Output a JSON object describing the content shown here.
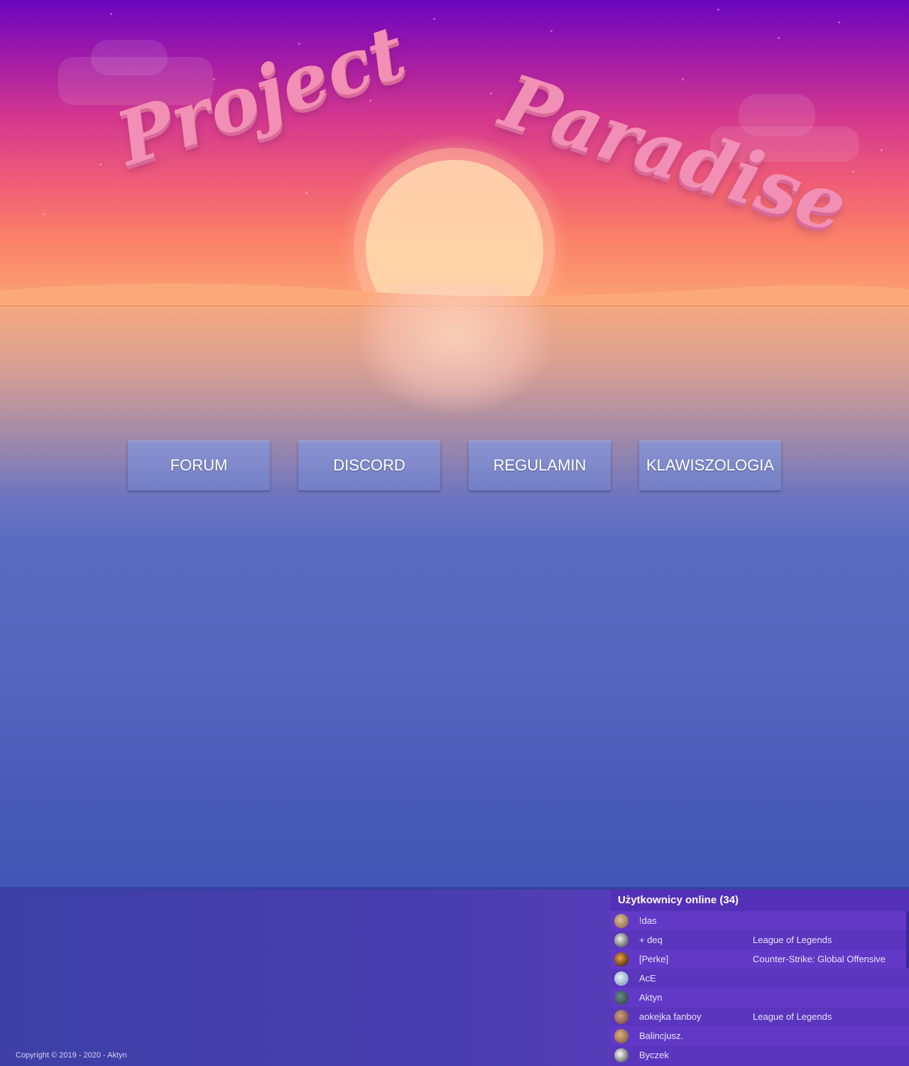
{
  "header": {
    "title_word_1": "Project",
    "title_word_2": "Paradise"
  },
  "nav": {
    "buttons": [
      {
        "label": "FORUM"
      },
      {
        "label": "DISCORD"
      },
      {
        "label": "REGULAMIN"
      },
      {
        "label": "KLAWISZOLOGIA"
      }
    ]
  },
  "footer": {
    "copyright": "Copyright © 2019 - 2020 - Aktyn"
  },
  "online_users": {
    "title": "Użytkownicy online (34)",
    "users": [
      {
        "name": "!das",
        "game": "",
        "avatar_color": "#b08a6a"
      },
      {
        "name": "+ deq",
        "game": "League of Legends",
        "avatar_color": "#c8c8c8"
      },
      {
        "name": "[Perke]",
        "game": "Counter-Strike: Global Offensive",
        "avatar_color": "#c07a2a"
      },
      {
        "name": "AcE",
        "game": "",
        "avatar_color": "#9ab0c0"
      },
      {
        "name": "Aktyn",
        "game": "",
        "avatar_color": "#3a5a5a"
      },
      {
        "name": "aokejka fanboy",
        "game": "League of Legends",
        "avatar_color": "#a07050"
      },
      {
        "name": "Balincjusz.",
        "game": "",
        "avatar_color": "#c09060"
      },
      {
        "name": "Byczek",
        "game": "",
        "avatar_color": "#e0e0e0"
      }
    ]
  },
  "colors": {
    "sky_top": "#6a06c0",
    "sky_bottom": "#fca476",
    "sun": "#ffd3a8",
    "sea": "#5567be",
    "button": "#7f89cb",
    "title": "#f28fb4",
    "online_panel": "#5a36bf"
  }
}
